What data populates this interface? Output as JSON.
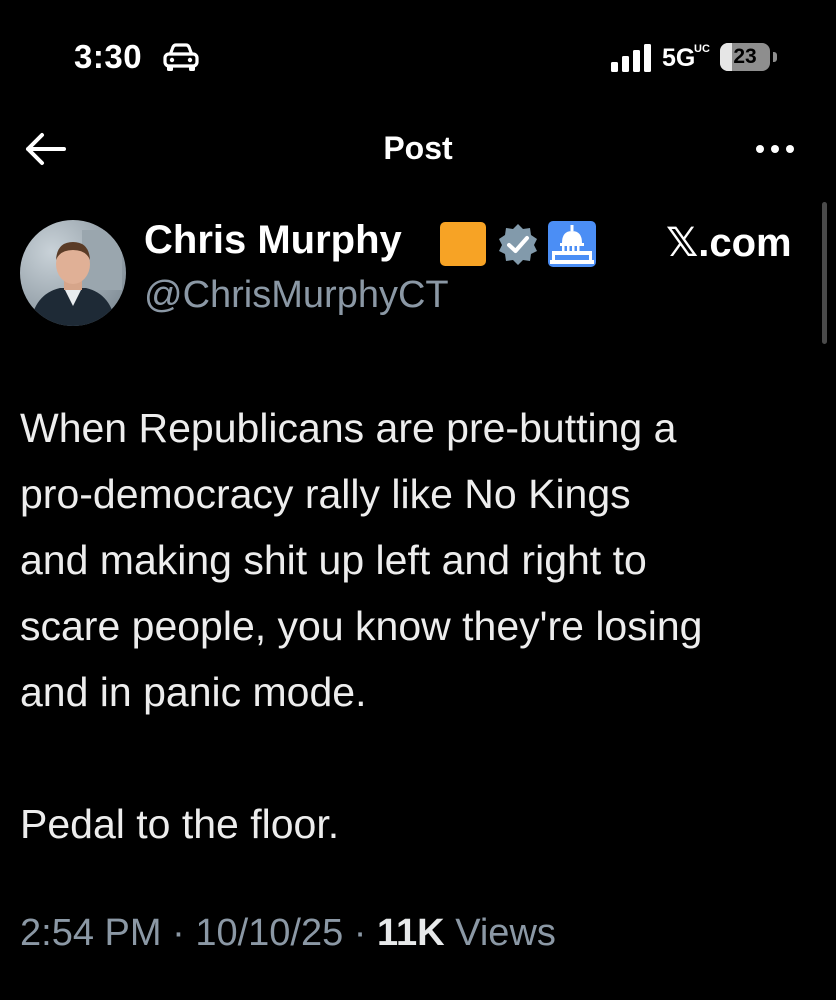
{
  "status_bar": {
    "time": "3:30",
    "network": "5G",
    "network_sub": "UC",
    "battery_percent": "23",
    "battery_level": 0.23,
    "icons": [
      "car-icon",
      "signal-icon"
    ]
  },
  "header": {
    "title": "Post",
    "icons": [
      "back-arrow-icon",
      "more-icon"
    ]
  },
  "author": {
    "name": "Chris Murphy",
    "handle": "@ChrisMurphyCT",
    "badges": [
      "orange-square",
      "verified-icon",
      "capitol-icon"
    ]
  },
  "source_label": "𝕏.com",
  "post": {
    "lines": [
      "When Republicans are pre-butting a",
      "pro-democracy rally like No Kings",
      "and making shit up left and right to",
      "scare people, you know they're losing",
      "and in panic mode."
    ],
    "closing": "Pedal to the floor."
  },
  "meta": {
    "time": "2:54 PM",
    "separator": "·",
    "date": "10/10/25",
    "views_count": "11K",
    "views_label": "Views"
  },
  "colors": {
    "background": "#000000",
    "text": "#e7e9ea",
    "secondary_text": "#8b98a5",
    "verified_badge": "#829aab",
    "orange_badge": "#f7a325",
    "capitol_badge": "#4b8ef5"
  }
}
